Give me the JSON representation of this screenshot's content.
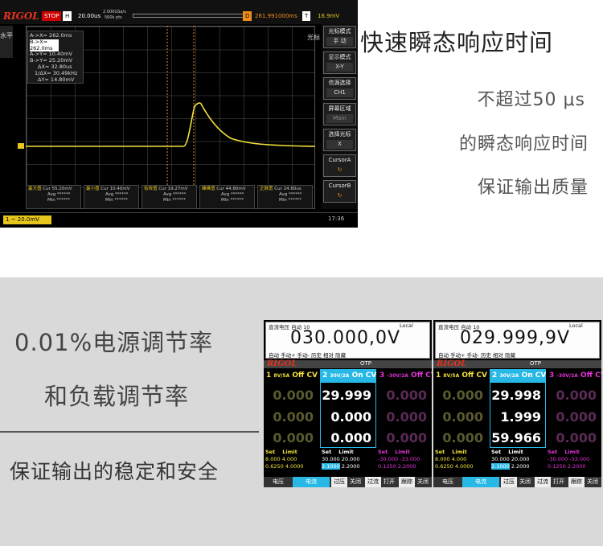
{
  "oscilloscope": {
    "logo": "RIGOL",
    "status": "STOP",
    "hbase_label": "H",
    "hbase": "20.00us",
    "sample": "2.000GSa/s",
    "points": "560k pts",
    "delay_label": "D",
    "delay": "261.991000ms",
    "trigger_label": "T",
    "trigger": "16.9mV",
    "left_tab": "水平",
    "right_tab": "光标",
    "measurements": [
      "A->X= 262.0ms",
      "B->X= 262.0ms",
      "A->Y= 10.40mV",
      "B->Y= 25.20mV",
      "ΔX= 32.80us",
      "1/ΔX= 30.49kHz",
      "ΔY= 14.80mV"
    ],
    "menu": [
      {
        "title": "光标模式",
        "value": "手 动"
      },
      {
        "title": "显示模式",
        "value": "X-Y"
      },
      {
        "title": "信源选择",
        "value": "CH1"
      },
      {
        "title": "屏幕区域",
        "value": "Main"
      },
      {
        "title": "选择光标",
        "value": "X"
      },
      {
        "title": "CursorA",
        "value": "↻"
      },
      {
        "title": "CursorB",
        "value": "↻"
      }
    ],
    "meas_cells": [
      {
        "name": "最大值",
        "cur": "Cur 55.20mV"
      },
      {
        "name": "最小值",
        "cur": "Cur 10.40mV"
      },
      {
        "name": "有效值",
        "cur": "Cur 19.27mV"
      },
      {
        "name": "峰峰值",
        "cur": "Cur 44.80mV"
      },
      {
        "name": "正脉宽",
        "cur": "Cur 24.80us"
      }
    ],
    "stat_lines": [
      "Avg ******",
      "Min ******",
      "Max ******"
    ],
    "channel": "1 ~ 20.0mV",
    "time": "17:36",
    "trigger_mark": "T"
  },
  "headline": {
    "title": "快速瞬态响应时间",
    "line1": "不超过50 μs",
    "line2": "的瞬态响应时间",
    "line3": "保证输出质量"
  },
  "band": {
    "line1": "0.01%电源调节率",
    "line2": "和负载调节率",
    "line3": "保证输出的稳定和安全"
  },
  "psu": [
    {
      "lcd_title": "直流电压 自动 10",
      "lcd_mode": "Local",
      "lcd_value": "030.000,0V",
      "lcd_buttons": "自动 手动+ 手动- 历史 相对 隐藏",
      "logo": "RIGOL",
      "otp": "OTP",
      "ch": [
        {
          "num": "1",
          "range": "8V/5A",
          "state": "Off CV"
        },
        {
          "num": "2",
          "range": "30V/2A",
          "state": "On CV"
        },
        {
          "num": "3",
          "range": "-30V/2A",
          "state": "Off CV"
        }
      ],
      "readings": [
        [
          "0.000",
          "29.999",
          "0.000"
        ],
        [
          "0.000",
          "0.000",
          "0.000"
        ],
        [
          "0.000",
          "0.000",
          "0.000"
        ]
      ],
      "units": [
        "V",
        "A",
        "W"
      ],
      "set_label": "Set",
      "limit_label": "Limit",
      "sets": [
        [
          "8.000",
          "4.000"
        ],
        [
          "30.000",
          "20.000"
        ],
        [
          "-30.000",
          "-33.000"
        ]
      ],
      "sets2": [
        [
          "0.6250",
          "4.0000"
        ],
        [
          "2.1000",
          "2.2000"
        ],
        [
          "0.1250",
          "2.2000"
        ]
      ],
      "tabs": [
        "电压",
        "电流",
        "过压",
        "关闭",
        "过流",
        "打开",
        "跟踪",
        "关闭"
      ]
    },
    {
      "lcd_title": "直流电压 自动 10",
      "lcd_mode": "Local",
      "lcd_value": "029.999,9V",
      "lcd_buttons": "自动 手动+ 手动- 历史 相对 隐藏",
      "logo": "RIGOL",
      "otp": "OTP",
      "ch": [
        {
          "num": "1",
          "range": "8V/5A",
          "state": "Off CV"
        },
        {
          "num": "2",
          "range": "30V/2A",
          "state": "On CV"
        },
        {
          "num": "3",
          "range": "-30V/2A",
          "state": "Off CV"
        }
      ],
      "readings": [
        [
          "0.000",
          "29.998",
          "0.000"
        ],
        [
          "0.000",
          "1.999",
          "0.000"
        ],
        [
          "0.000",
          "59.966",
          "0.000"
        ]
      ],
      "units": [
        "V",
        "A",
        "W"
      ],
      "set_label": "Set",
      "limit_label": "Limit",
      "sets": [
        [
          "8.000",
          "4.000"
        ],
        [
          "30.000",
          "20.000"
        ],
        [
          "-30.000",
          "-33.000"
        ]
      ],
      "sets2": [
        [
          "0.6250",
          "4.0000"
        ],
        [
          "2.1000",
          "2.2000"
        ],
        [
          "0.1250",
          "2.2000"
        ]
      ],
      "tabs": [
        "电压",
        "电流",
        "过压",
        "关闭",
        "过流",
        "打开",
        "跟踪",
        "关闭"
      ]
    }
  ]
}
